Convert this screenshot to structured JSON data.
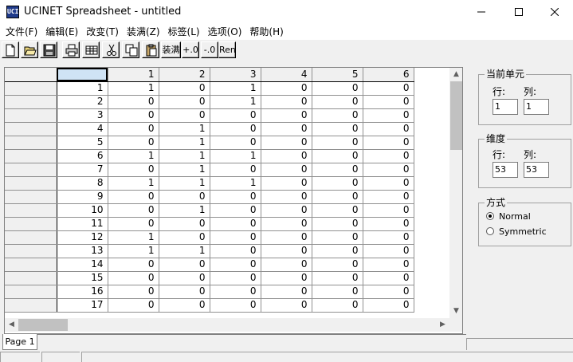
{
  "window": {
    "title": "UCINET Spreadsheet - untitled",
    "icon_text": "UCI"
  },
  "menu": [
    "文件(F)",
    "编辑(E)",
    "改变(T)",
    "装满(Z)",
    "标签(L)",
    "选项(O)",
    "帮助(H)"
  ],
  "toolbar": {
    "icons": [
      "new-file-icon",
      "open-folder-icon",
      "save-disk-icon",
      "print-icon",
      "table-icon",
      "cut-icon",
      "copy-icon",
      "paste-icon"
    ],
    "fill_label": "装满",
    "plus_label": "+.0",
    "minus_label": "-.0",
    "ren_label": "Ren"
  },
  "grid": {
    "col_headers": [
      "",
      "1",
      "2",
      "3",
      "4",
      "5",
      "6"
    ],
    "rows": [
      {
        "label": "1",
        "cells": [
          "1",
          "0",
          "1",
          "0",
          "0",
          "0"
        ]
      },
      {
        "label": "2",
        "cells": [
          "0",
          "0",
          "1",
          "0",
          "0",
          "0"
        ]
      },
      {
        "label": "3",
        "cells": [
          "0",
          "0",
          "0",
          "0",
          "0",
          "0"
        ]
      },
      {
        "label": "4",
        "cells": [
          "0",
          "1",
          "0",
          "0",
          "0",
          "0"
        ]
      },
      {
        "label": "5",
        "cells": [
          "0",
          "1",
          "0",
          "0",
          "0",
          "0"
        ]
      },
      {
        "label": "6",
        "cells": [
          "1",
          "1",
          "1",
          "0",
          "0",
          "0"
        ]
      },
      {
        "label": "7",
        "cells": [
          "0",
          "1",
          "0",
          "0",
          "0",
          "0"
        ]
      },
      {
        "label": "8",
        "cells": [
          "1",
          "1",
          "1",
          "0",
          "0",
          "0"
        ]
      },
      {
        "label": "9",
        "cells": [
          "0",
          "0",
          "0",
          "0",
          "0",
          "0"
        ]
      },
      {
        "label": "10",
        "cells": [
          "0",
          "1",
          "0",
          "0",
          "0",
          "0"
        ]
      },
      {
        "label": "11",
        "cells": [
          "0",
          "0",
          "0",
          "0",
          "0",
          "0"
        ]
      },
      {
        "label": "12",
        "cells": [
          "1",
          "0",
          "0",
          "0",
          "0",
          "0"
        ]
      },
      {
        "label": "13",
        "cells": [
          "1",
          "1",
          "0",
          "0",
          "0",
          "0"
        ]
      },
      {
        "label": "14",
        "cells": [
          "0",
          "0",
          "0",
          "0",
          "0",
          "0"
        ]
      },
      {
        "label": "15",
        "cells": [
          "0",
          "0",
          "0",
          "0",
          "0",
          "0"
        ]
      },
      {
        "label": "16",
        "cells": [
          "0",
          "0",
          "0",
          "0",
          "0",
          "0"
        ]
      },
      {
        "label": "17",
        "cells": [
          "0",
          "0",
          "0",
          "0",
          "0",
          "0"
        ]
      }
    ]
  },
  "page_tab": "Page 1",
  "current_cell": {
    "title": "当前单元",
    "row_label": "行:",
    "col_label": "列:",
    "row_value": "1",
    "col_value": "1"
  },
  "dimensions": {
    "title": "维度",
    "row_label": "行:",
    "col_label": "列:",
    "row_value": "53",
    "col_value": "53"
  },
  "mode": {
    "title": "方式",
    "options": [
      "Normal",
      "Symmetric"
    ],
    "selected": "Normal"
  }
}
